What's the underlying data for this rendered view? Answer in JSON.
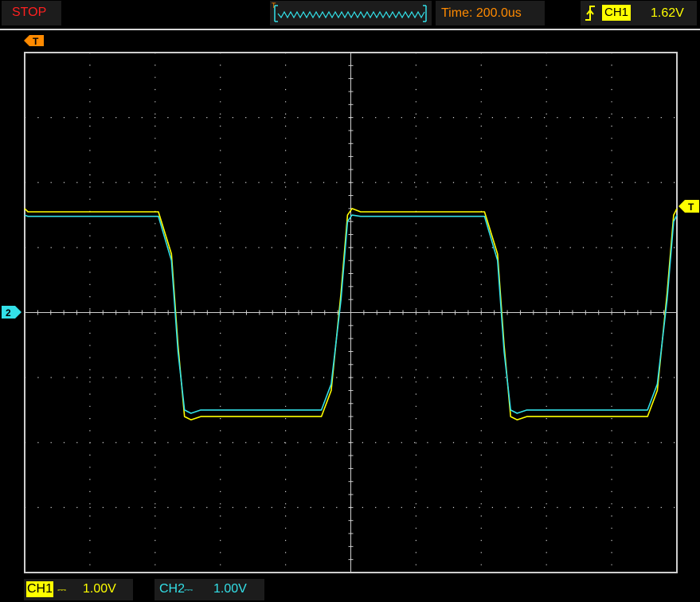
{
  "status": {
    "run_state": "STOP"
  },
  "preview": {
    "trigger_glyph": "T"
  },
  "timebase": {
    "label": "Time: 200.0us"
  },
  "trigger": {
    "edge_icon": "rising-edge-icon",
    "channel": "CH1",
    "level": "1.62V"
  },
  "markers": {
    "trigger_position_label": "T",
    "trigger_level_label": "T",
    "ch2_ground_label": "2"
  },
  "channels": [
    {
      "name": "CH1",
      "coupling": "⎓",
      "scale": "1.00V",
      "color": "#ffff00"
    },
    {
      "name": "CH2",
      "coupling": "⎓",
      "scale": "1.00V",
      "color": "#33e0e8"
    }
  ],
  "colors": {
    "grid": "#cfcfcf",
    "ch1": "#ffff00",
    "ch2": "#33e0e8",
    "stop": "#ff2020",
    "timebase": "#ff8a00",
    "trigger_marker": "#ff8a00"
  },
  "chart_data": {
    "type": "line",
    "x_divisions": 10,
    "y_divisions": 8,
    "x_unit_per_div": "200.0us",
    "y_unit_per_div": "1.00V",
    "series": [
      {
        "name": "CH1",
        "x": [
          0,
          0.05,
          2.05,
          2.25,
          2.35,
          2.45,
          2.55,
          2.7,
          4.55,
          4.7,
          4.85,
          4.95,
          5.02,
          5.15,
          7.05,
          7.25,
          7.35,
          7.45,
          7.55,
          7.7,
          9.55,
          9.7,
          9.85,
          9.95,
          10.0
        ],
        "y": [
          1.6,
          1.55,
          1.55,
          0.9,
          -0.5,
          -1.6,
          -1.65,
          -1.6,
          -1.6,
          -1.2,
          0.3,
          1.5,
          1.6,
          1.55,
          1.55,
          0.9,
          -0.5,
          -1.6,
          -1.65,
          -1.6,
          -1.6,
          -1.2,
          0.3,
          1.5,
          1.6
        ]
      },
      {
        "name": "CH2",
        "x": [
          0,
          0.05,
          2.05,
          2.25,
          2.35,
          2.45,
          2.55,
          2.7,
          4.55,
          4.7,
          4.85,
          4.95,
          5.02,
          5.15,
          7.05,
          7.25,
          7.35,
          7.45,
          7.55,
          7.7,
          9.55,
          9.7,
          9.85,
          9.95,
          10.0
        ],
        "y": [
          1.5,
          1.48,
          1.48,
          0.8,
          -0.6,
          -1.5,
          -1.55,
          -1.5,
          -1.5,
          -1.1,
          0.2,
          1.4,
          1.5,
          1.48,
          1.48,
          0.8,
          -0.6,
          -1.5,
          -1.55,
          -1.5,
          -1.5,
          -1.1,
          0.2,
          1.4,
          1.5
        ]
      }
    ]
  }
}
